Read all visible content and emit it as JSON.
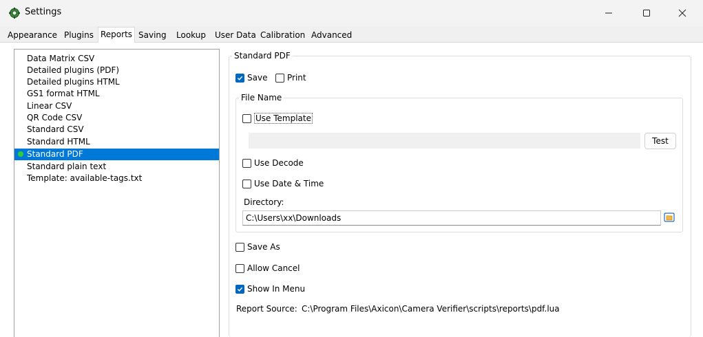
{
  "window": {
    "title": "Settings",
    "icon": "gear-cog-icon",
    "controls": {
      "minimize": "—",
      "maximize": "☐",
      "close": "✕"
    }
  },
  "tabs": [
    {
      "label": "Appearance",
      "active": false
    },
    {
      "label": "Plugins",
      "active": false
    },
    {
      "label": "Reports",
      "active": true
    },
    {
      "label": "Saving",
      "active": false
    },
    {
      "label": "Lookup",
      "active": false
    },
    {
      "label": "User Data",
      "active": false
    },
    {
      "label": "Calibration",
      "active": false
    },
    {
      "label": "Advanced",
      "active": false
    }
  ],
  "reports_list": {
    "items": [
      "Data Matrix CSV",
      "Detailed plugins (PDF)",
      "Detailed plugins HTML",
      "GS1 format HTML",
      "Linear CSV",
      "QR Code CSV",
      "Standard CSV",
      "Standard HTML",
      "Standard PDF",
      "Standard plain text",
      "Template: available-tags.txt"
    ],
    "selected_index": 8,
    "active_indicator_color": "#2ecc40",
    "selection_color": "#0078d7"
  },
  "details": {
    "group_title": "Standard PDF",
    "save": {
      "label": "Save",
      "checked": true
    },
    "print": {
      "label": "Print",
      "checked": false
    },
    "file_name": {
      "group_title": "File Name",
      "use_template": {
        "label": "Use Template",
        "checked": false
      },
      "template_value": "",
      "test_button": "Test",
      "use_decode": {
        "label": "Use Decode",
        "checked": false
      },
      "use_date_time": {
        "label": "Use Date & Time",
        "checked": false
      },
      "directory_label": "Directory:",
      "directory_value": "C:\\Users\\xx\\Downloads",
      "browse_icon": "folder-browse-icon"
    },
    "save_as": {
      "label": "Save As",
      "checked": false
    },
    "allow_cancel": {
      "label": "Allow Cancel",
      "checked": false
    },
    "show_in_menu": {
      "label": "Show In Menu",
      "checked": true
    },
    "report_source_label": "Report Source:",
    "report_source_value": "C:\\Program Files\\Axicon\\Camera Verifier\\scripts\\reports\\pdf.lua"
  },
  "colors": {
    "checkbox_checked": "#0067c0"
  }
}
